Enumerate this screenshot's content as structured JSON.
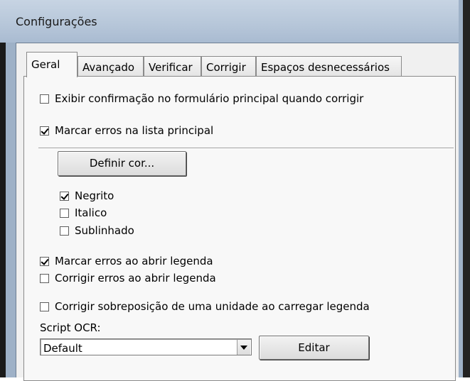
{
  "window": {
    "title": "Configurações"
  },
  "tabs": [
    {
      "label": "Geral",
      "active": true
    },
    {
      "label": "Avançado",
      "active": false
    },
    {
      "label": "Verificar",
      "active": false
    },
    {
      "label": "Corrigir",
      "active": false
    },
    {
      "label": "Espaços desnecessários",
      "active": false
    }
  ],
  "general": {
    "show_confirmation": {
      "label": "Exibir confirmação no formulário principal quando corrigir",
      "checked": false
    },
    "mark_errors_main_list": {
      "label": "Marcar erros na lista principal",
      "checked": true
    },
    "define_color_button": "Definir cor...",
    "bold": {
      "label": "Negrito",
      "checked": true
    },
    "italic": {
      "label": "Italico",
      "checked": false
    },
    "underline": {
      "label": "Sublinhado",
      "checked": false
    },
    "mark_errors_open": {
      "label": "Marcar erros ao abrir legenda",
      "checked": true
    },
    "fix_errors_open": {
      "label": "Corrigir erros ao abrir legenda",
      "checked": false
    },
    "fix_overlap": {
      "label": "Corrigir sobreposição de uma unidade ao carregar legenda",
      "checked": false
    },
    "ocr_script_label": "Script OCR:",
    "ocr_script_value": "Default",
    "edit_button": "Editar"
  }
}
